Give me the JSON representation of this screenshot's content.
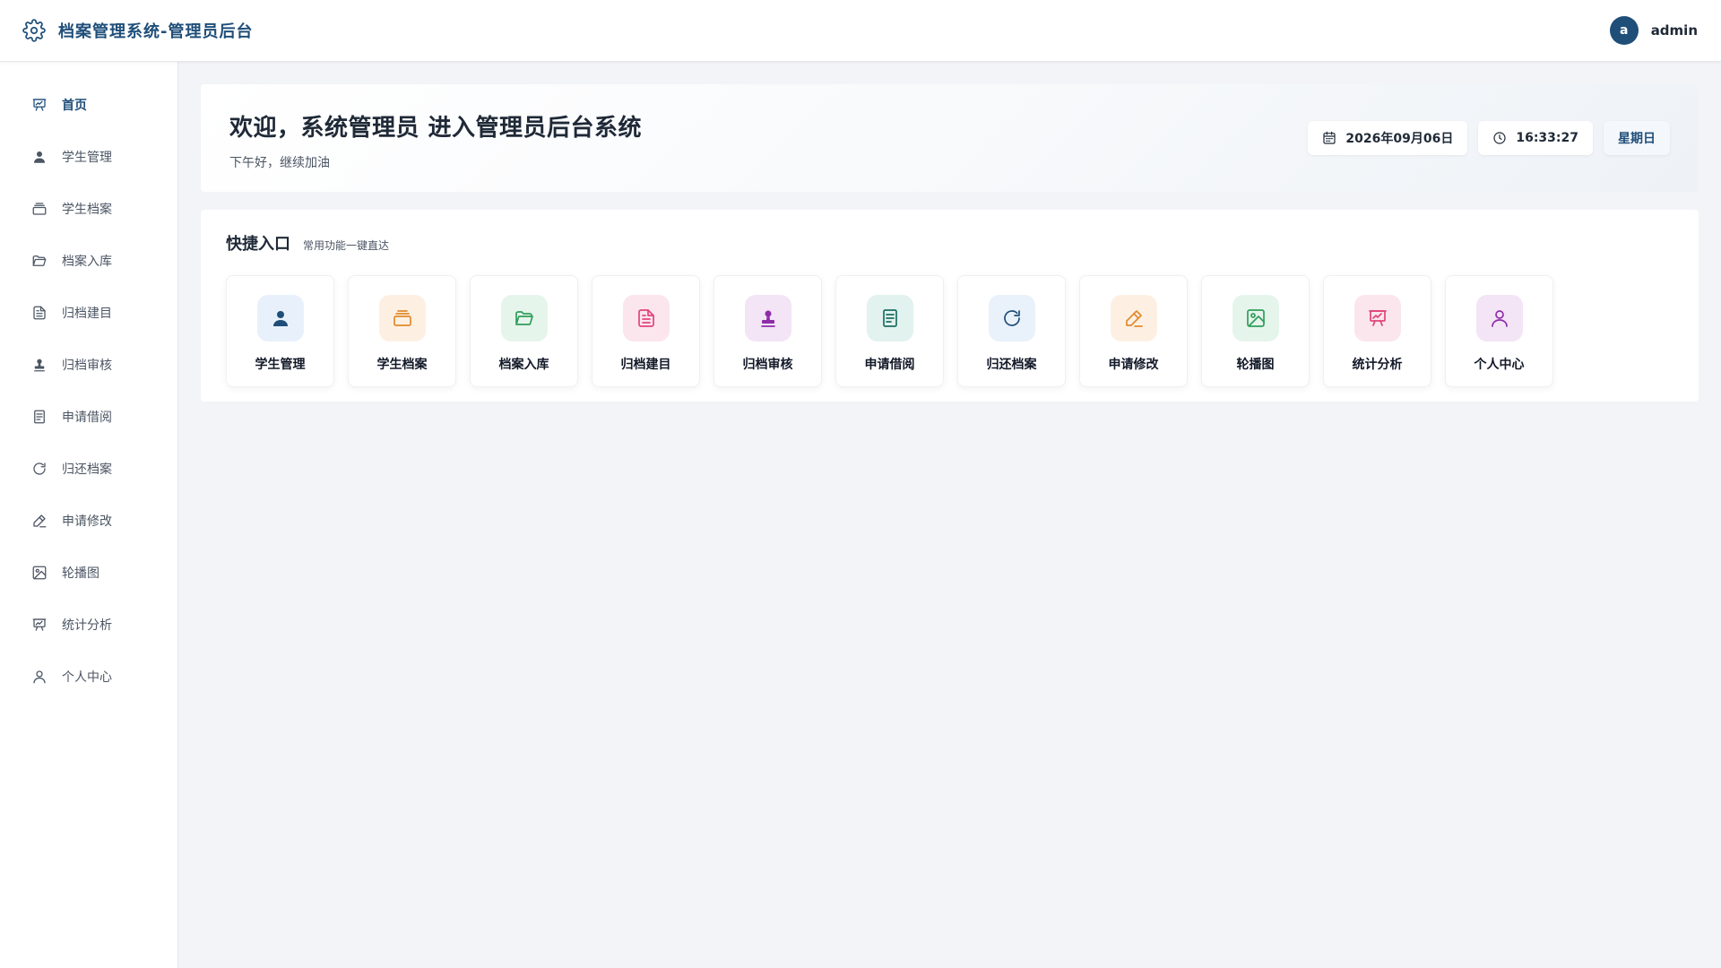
{
  "app": {
    "title": "档案管理系统-管理员后台"
  },
  "user": {
    "avatar_letter": "a",
    "name": "admin"
  },
  "sidebar": {
    "items": [
      {
        "label": "首页",
        "icon": "presentation-chart-icon",
        "active": true
      },
      {
        "label": "学生管理",
        "icon": "user-solid-icon"
      },
      {
        "label": "学生档案",
        "icon": "stacked-folders-icon"
      },
      {
        "label": "档案入库",
        "icon": "folder-open-icon"
      },
      {
        "label": "归档建目",
        "icon": "document-text-icon"
      },
      {
        "label": "归档审核",
        "icon": "stamp-icon"
      },
      {
        "label": "申请借阅",
        "icon": "notes-icon"
      },
      {
        "label": "归还档案",
        "icon": "refresh-icon"
      },
      {
        "label": "申请修改",
        "icon": "pen-edit-icon"
      },
      {
        "label": "轮播图",
        "icon": "image-icon"
      },
      {
        "label": "统计分析",
        "icon": "presentation-chart-icon"
      },
      {
        "label": "个人中心",
        "icon": "user-outline-icon"
      }
    ]
  },
  "welcome": {
    "title": "欢迎，系统管理员 进入管理员后台系统",
    "subtitle": "下午好，继续加油",
    "date": "2026年09月06日",
    "time": "16:33:27",
    "weekday": "星期日"
  },
  "quick": {
    "title": "快捷入口",
    "subtitle": "常用功能一键直达",
    "items": [
      {
        "label": "学生管理",
        "icon": "user-solid-icon",
        "color": "#1f4e79",
        "bg": "#e8f1fb"
      },
      {
        "label": "学生档案",
        "icon": "stacked-folders-icon",
        "color": "#e08a2c",
        "bg": "#fdf0e3"
      },
      {
        "label": "档案入库",
        "icon": "folder-open-icon",
        "color": "#2f9e5b",
        "bg": "#e6f5ec"
      },
      {
        "label": "归档建目",
        "icon": "document-text-icon",
        "color": "#e0457b",
        "bg": "#fbe6ee"
      },
      {
        "label": "归档审核",
        "icon": "stamp-icon",
        "color": "#8e2da8",
        "bg": "#f3e4f6"
      },
      {
        "label": "申请借阅",
        "icon": "notes-icon",
        "color": "#1b6f63",
        "bg": "#e2f2ef"
      },
      {
        "label": "归还档案",
        "icon": "refresh-icon",
        "color": "#1f4e79",
        "bg": "#e9f1fa"
      },
      {
        "label": "申请修改",
        "icon": "pen-edit-icon",
        "color": "#e08a2c",
        "bg": "#fdf0e3"
      },
      {
        "label": "轮播图",
        "icon": "image-icon",
        "color": "#2f9e5b",
        "bg": "#e6f5ec"
      },
      {
        "label": "统计分析",
        "icon": "presentation-chart-icon",
        "color": "#e0457b",
        "bg": "#fbe6ee"
      },
      {
        "label": "个人中心",
        "icon": "user-outline-icon",
        "color": "#8e2da8",
        "bg": "#f3e4f6"
      }
    ]
  }
}
